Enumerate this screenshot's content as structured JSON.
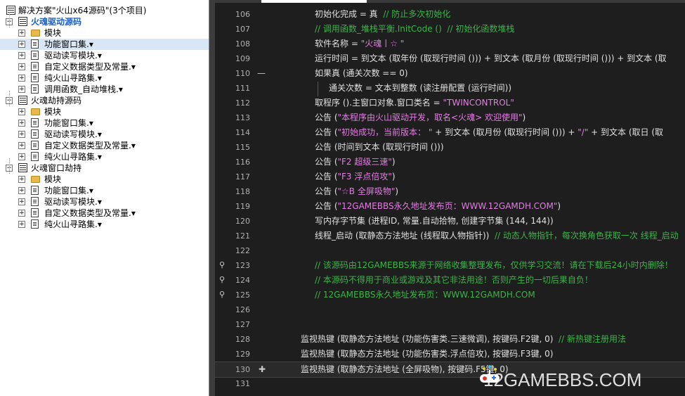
{
  "tree": {
    "root_label": "解决方案\"火山x64源码\"(3个项目)",
    "projects": [
      {
        "name": "火魂驱动源码",
        "items": [
          "模块",
          "功能窗口集.▾",
          "驱动读写模块.▾",
          "自定义数据类型及常量.▾",
          "纯火山寻路集.▾",
          "调用函数_自动堆栈.▾"
        ]
      },
      {
        "name": "火魂劫持源码",
        "items": [
          "模块",
          "功能窗口集.▾",
          "驱动读写模块.▾",
          "自定义数据类型及常量.▾",
          "纯火山寻路集.▾"
        ]
      },
      {
        "name": "火魂窗口劫持",
        "items": [
          "模块",
          "功能窗口集.▾",
          "驱动读写模块.▾",
          "自定义数据类型及常量.▾",
          "纯火山寻路集.▾"
        ]
      }
    ]
  },
  "editor": {
    "lines": [
      {
        "n": "106",
        "text": "初始化完成 = 真  // 防止多次初始化"
      },
      {
        "n": "107",
        "text": "// 调用函数_堆栈平衡.InitCode ()  // 初始化函数堆栈"
      },
      {
        "n": "108",
        "text": "软件名称 = \"火魂丨☆ \""
      },
      {
        "n": "109",
        "text": "运行时间 = 到文本 (取年份 (取现行时间 ())) + 到文本 (取月份 (取现行时间 ())) + 到文本 (取"
      },
      {
        "n": "110",
        "text": "如果真 (通关次数 == 0)"
      },
      {
        "n": "111",
        "text": "通关次数 = 文本到整数 (读注册配置 (运行时间))"
      },
      {
        "n": "112",
        "text": "取程序 ().主窗口对象.窗口类名 = \"TWINCONTROL\""
      },
      {
        "n": "113",
        "text": "公告 (\"本程序由火山驱动开发，取名<火魂> 欢迎使用\")"
      },
      {
        "n": "114",
        "text": "公告 (\"初始成功，当前版本： \" + 到文本 (取月份 (取现行时间 ())) + \"/\" + 到文本 (取日 (取"
      },
      {
        "n": "115",
        "text": "公告 (时间到文本 (取现行时间 ()))"
      },
      {
        "n": "116",
        "text": "公告 (\"F2 超级三速\")"
      },
      {
        "n": "117",
        "text": "公告 (\"F3 浮点倍攻\")"
      },
      {
        "n": "118",
        "text": "公告 (\"☆B 全屏吸物\")"
      },
      {
        "n": "119",
        "text": "公告 (\"12GAMEBBS永久地址发布页：WWW.12GAMDH.COM\")"
      },
      {
        "n": "120",
        "text": "写内存字节集 (进程ID, 常量.自动拾物, 创建字节集 (144, 144))"
      },
      {
        "n": "121",
        "text": "线程_启动 (取静态方法地址 (线程取人物指针))  // 动态人物指针，每次换角色获取一次 线程_启动"
      },
      {
        "n": "122",
        "text": ""
      },
      {
        "n": "123",
        "text": "// 该源码由12GAMEBBS来源于网络收集整理发布，仅供学习交流！请在下载后24小时内删除！"
      },
      {
        "n": "124",
        "text": "// 本源码不得用于商业或游戏及其它非法用途！否则产生的一切后果自负！"
      },
      {
        "n": "125",
        "text": "// 12GAMEBBS永久地址发布页：WWW.12GAMDH.COM"
      },
      {
        "n": "126",
        "text": ""
      },
      {
        "n": "127",
        "text": ""
      },
      {
        "n": "128",
        "text": "监视热键 (取静态方法地址 (功能伤害类.三速微调), 按键码.F2键, 0)  // 新热键注册用法"
      },
      {
        "n": "129",
        "text": "监视热键 (取静态方法地址 (功能伤害类.浮点倍攻), 按键码.F3键, 0)"
      },
      {
        "n": "130",
        "text": "监视热键 (取静态方法地址 (全屏吸物), 按键码.F5键, 0)"
      },
      {
        "n": "131",
        "text": ""
      }
    ]
  },
  "watermark": "12GAMEBBS.COM"
}
